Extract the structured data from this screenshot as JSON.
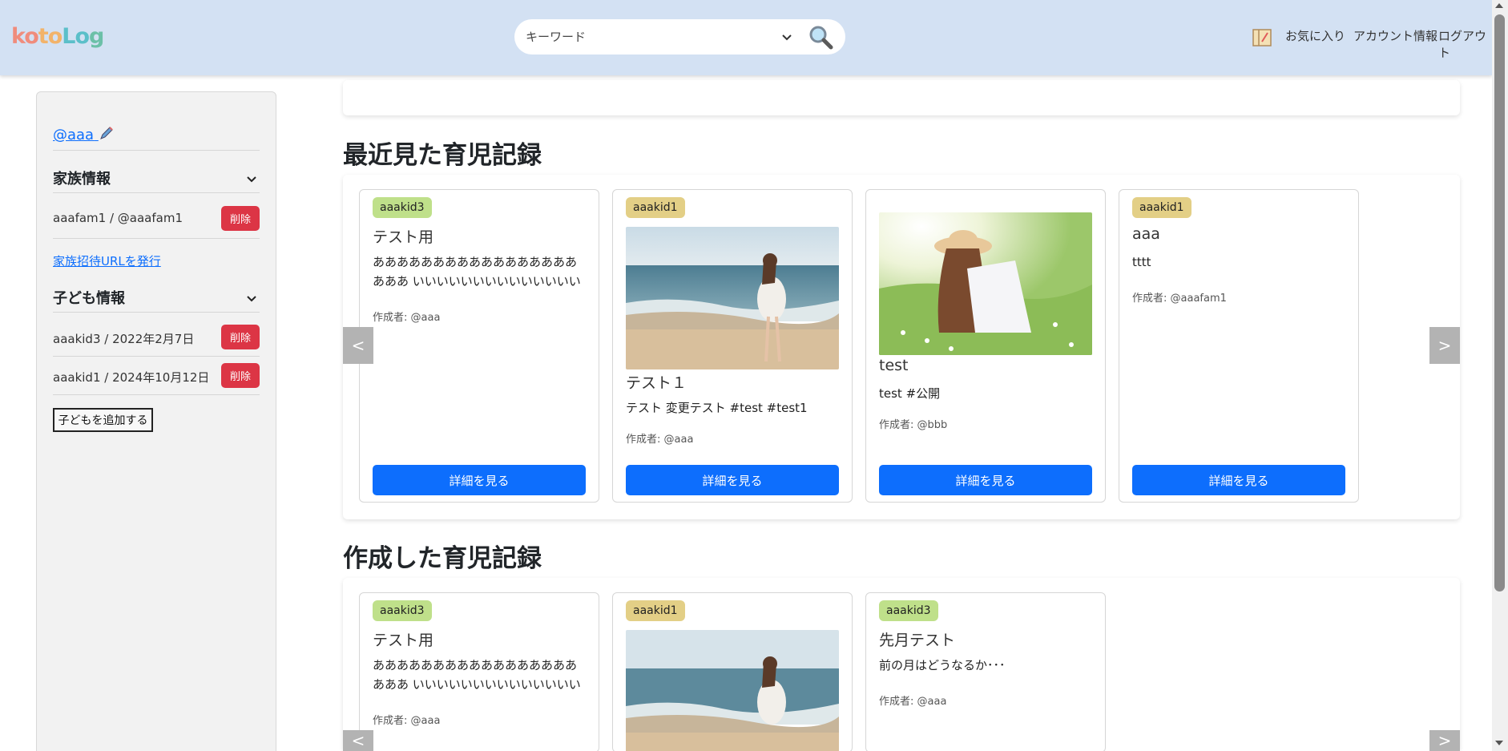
{
  "header": {
    "logo": {
      "k": "ko",
      "t": "to",
      "l": "Lo",
      "g": "g"
    },
    "search_placeholder": "キーワード",
    "nav": {
      "favorites": "お気に入り",
      "account": "アカウント情報",
      "logout": "ログアウト"
    }
  },
  "sidebar": {
    "username": "@aaa",
    "family_heading": "家族情報",
    "family_members": [
      {
        "text": "aaafam1 / @aaafam1",
        "delete": "削除"
      }
    ],
    "invite_link": "家族招待URLを発行",
    "children_heading": "子ども情報",
    "children": [
      {
        "text": "aaakid3 / 2022年2月7日",
        "delete": "削除"
      },
      {
        "text": "aaakid1 / 2024年10月12日",
        "delete": "削除"
      }
    ],
    "add_child": "子どもを追加する"
  },
  "recent": {
    "title": "最近見た育児記録",
    "prev": "<",
    "next": ">",
    "cards": [
      {
        "badge": "aaakid3",
        "title": "テスト用",
        "desc": "ああああああああああああああああああああ いいいいいいいいいいいいいいいいいいいい...",
        "author": "作成者: @aaa",
        "button": "詳細を見る"
      },
      {
        "badge": "aaakid1",
        "title": "テスト１",
        "desc": "テスト 変更テスト #test #test1",
        "author": "作成者: @aaa",
        "button": "詳細を見る"
      },
      {
        "title": "test",
        "desc": "test #公開",
        "author": "作成者: @bbb",
        "button": "詳細を見る"
      },
      {
        "badge": "aaakid1",
        "title": "aaa",
        "desc": "tttt",
        "author": "作成者: @aaafam1",
        "button": "詳細を見る"
      }
    ]
  },
  "created": {
    "title": "作成した育児記録",
    "prev": "<",
    "next": ">",
    "cards": [
      {
        "badge": "aaakid3",
        "title": "テスト用",
        "desc": "ああああああああああああああああああああ いいいいいいいいいいいいいいいいいいいい...",
        "author": "作成者: @aaa"
      },
      {
        "badge": "aaakid1"
      },
      {
        "badge": "aaakid3",
        "title": "先月テスト",
        "desc": "前の月はどうなるか･･･",
        "author": "作成者: @aaa"
      }
    ]
  }
}
